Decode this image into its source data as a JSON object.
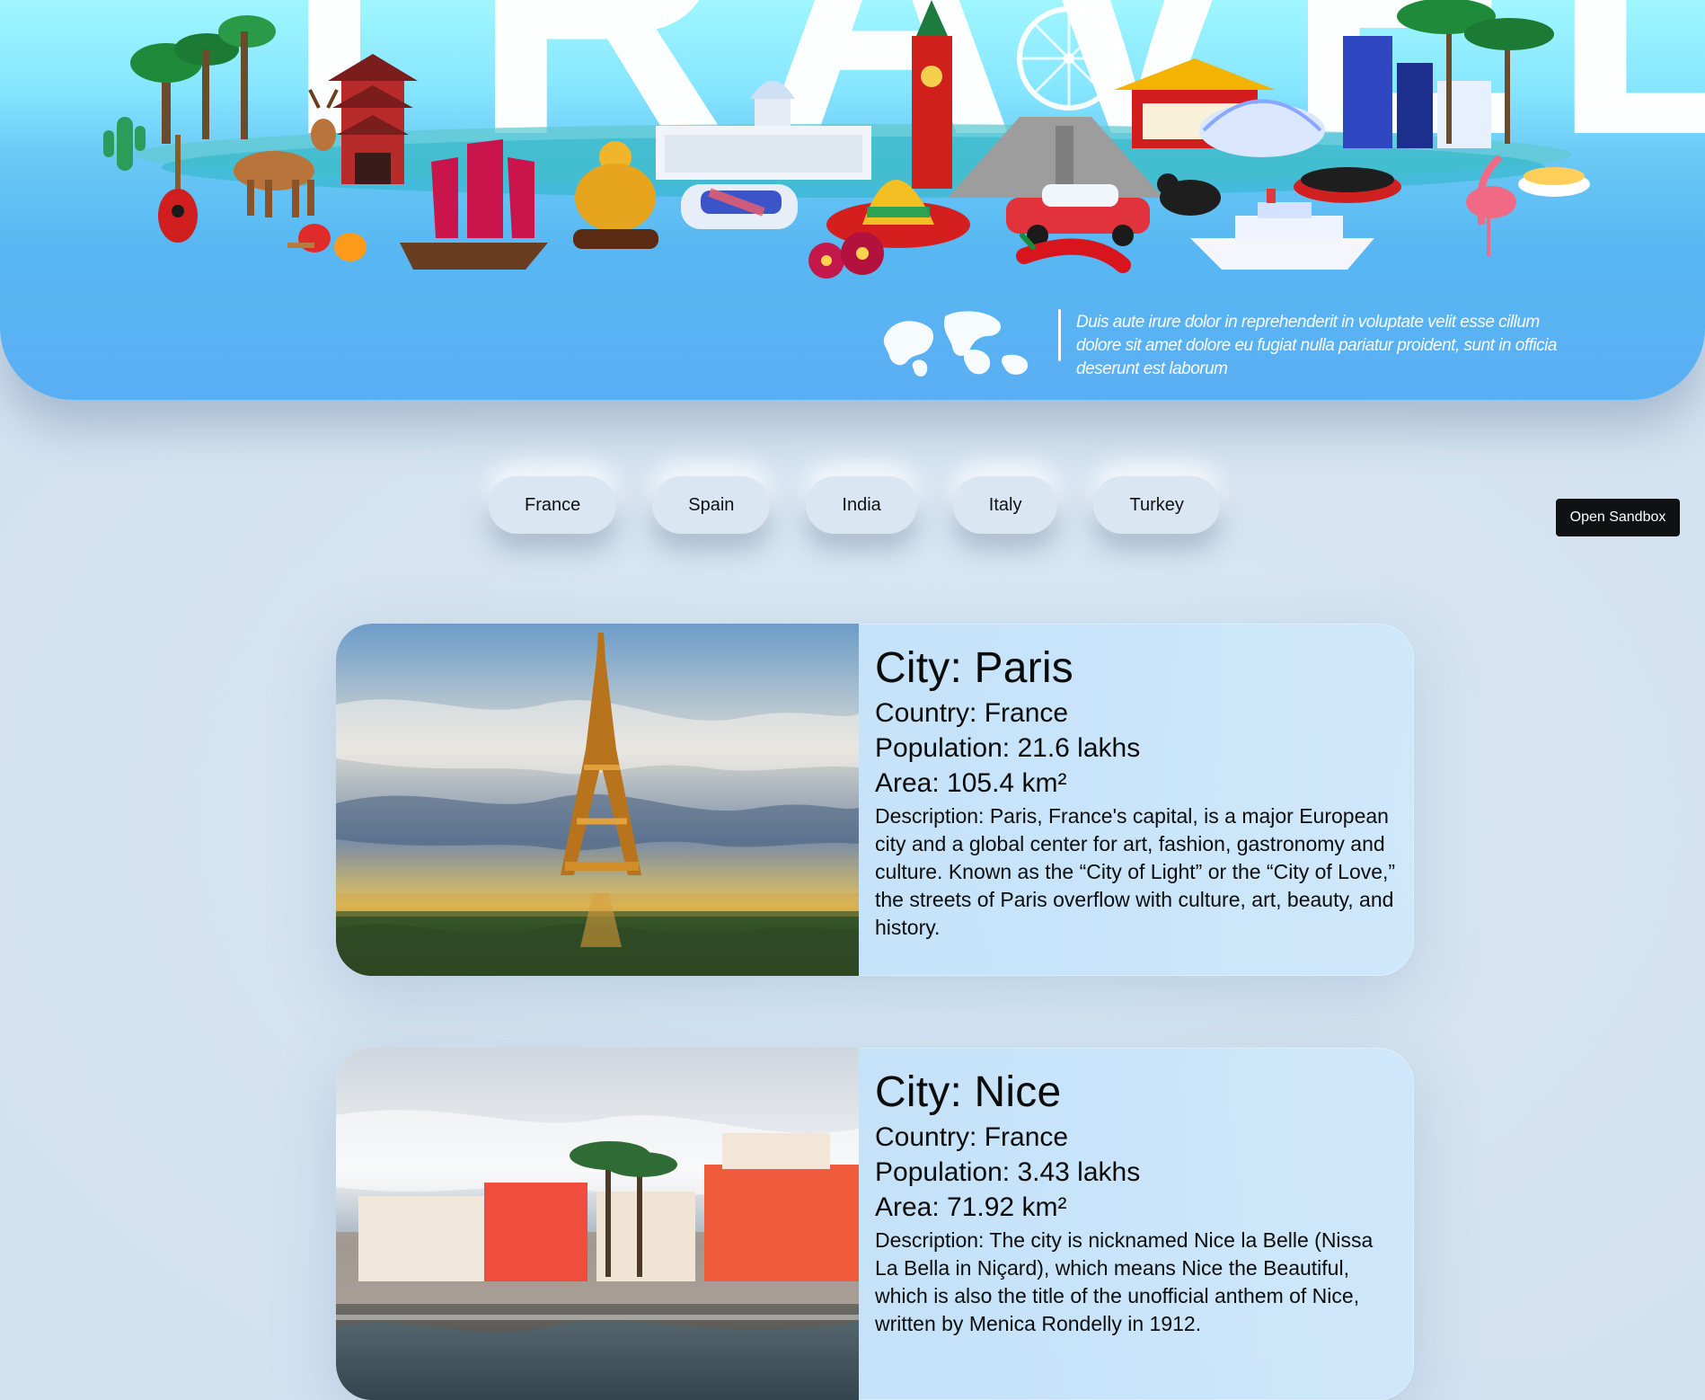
{
  "hero": {
    "title": "TRAVEL",
    "tagline": "Duis aute irure dolor in reprehenderit in voluptate velit esse cillum dolore sit amet dolore eu fugiat nulla pariatur proident, sunt in officia deserunt est laborum",
    "illustration_icons": [
      "guitar-icon",
      "deer-icon",
      "pagoda-icon",
      "palm-tree-icon",
      "junk-boat-icon",
      "buddha-icon",
      "train-icon",
      "sombrero-icon",
      "kremlin-tower-icon",
      "ferris-wheel-icon",
      "pyramid-icon",
      "temple-icon",
      "car-icon",
      "ship-icon",
      "flamingo-icon",
      "world-map-icon"
    ],
    "colors": {
      "sky_top": "#9ff6ff",
      "sky_bottom": "#5aaef3"
    }
  },
  "tabs": {
    "items": [
      {
        "label": "France"
      },
      {
        "label": "Spain"
      },
      {
        "label": "India"
      },
      {
        "label": "Italy"
      },
      {
        "label": "Turkey"
      }
    ],
    "active": "France"
  },
  "open_sandbox": {
    "label": "Open Sandbox"
  },
  "cities": [
    {
      "city": "City: Paris",
      "country": "Country: France",
      "population": "Population: 21.6 lakhs",
      "area": "Area: 105.4 km²",
      "description": "Description: Paris, France's capital, is a major European city and a global center for art, fashion, gastronomy and culture. Known as the “City of Light” or the “City of Love,” the streets of Paris overflow with culture, art, beauty, and history."
    },
    {
      "city": "City: Nice",
      "country": "Country: France",
      "population": "Population: 3.43 lakhs",
      "area": "Area: 71.92 km²",
      "description": "Description: The city is nicknamed Nice la Belle (Nissa La Bella in Niçard), which means Nice the Beautiful, which is also the title of the unofficial anthem of Nice, written by Menica Rondelly in 1912."
    }
  ]
}
